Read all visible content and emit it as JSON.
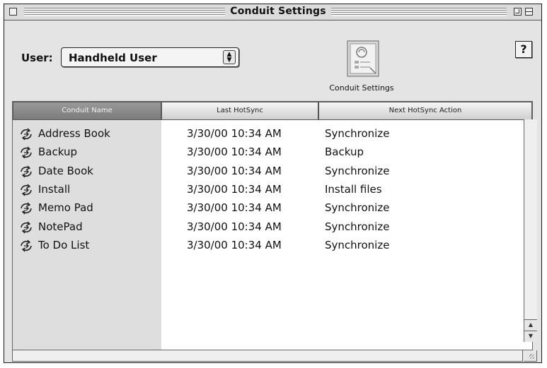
{
  "window": {
    "title": "Conduit Settings"
  },
  "user": {
    "label": "User:",
    "selected": "Handheld User"
  },
  "toolbar": {
    "conduit_settings_label": "Conduit Settings",
    "help_label": "?"
  },
  "table": {
    "columns": [
      "Conduit Name",
      "Last HotSync",
      "Next HotSync Action"
    ],
    "rows": [
      {
        "name": "Address Book",
        "last_hotsync": "3/30/00 10:34 AM",
        "action": "Synchronize"
      },
      {
        "name": "Backup",
        "last_hotsync": "3/30/00 10:34 AM",
        "action": "Backup"
      },
      {
        "name": "Date Book",
        "last_hotsync": "3/30/00 10:34 AM",
        "action": "Synchronize"
      },
      {
        "name": "Install",
        "last_hotsync": "3/30/00 10:34 AM",
        "action": "Install files"
      },
      {
        "name": "Memo Pad",
        "last_hotsync": "3/30/00 10:34 AM",
        "action": "Synchronize"
      },
      {
        "name": "NotePad",
        "last_hotsync": "3/30/00 10:34 AM",
        "action": "Synchronize"
      },
      {
        "name": "To Do List",
        "last_hotsync": "3/30/00 10:34 AM",
        "action": "Synchronize"
      }
    ]
  },
  "icons": {
    "row_icon": "conduit-arrows-icon",
    "settings_icon": "conduit-settings-icon"
  }
}
